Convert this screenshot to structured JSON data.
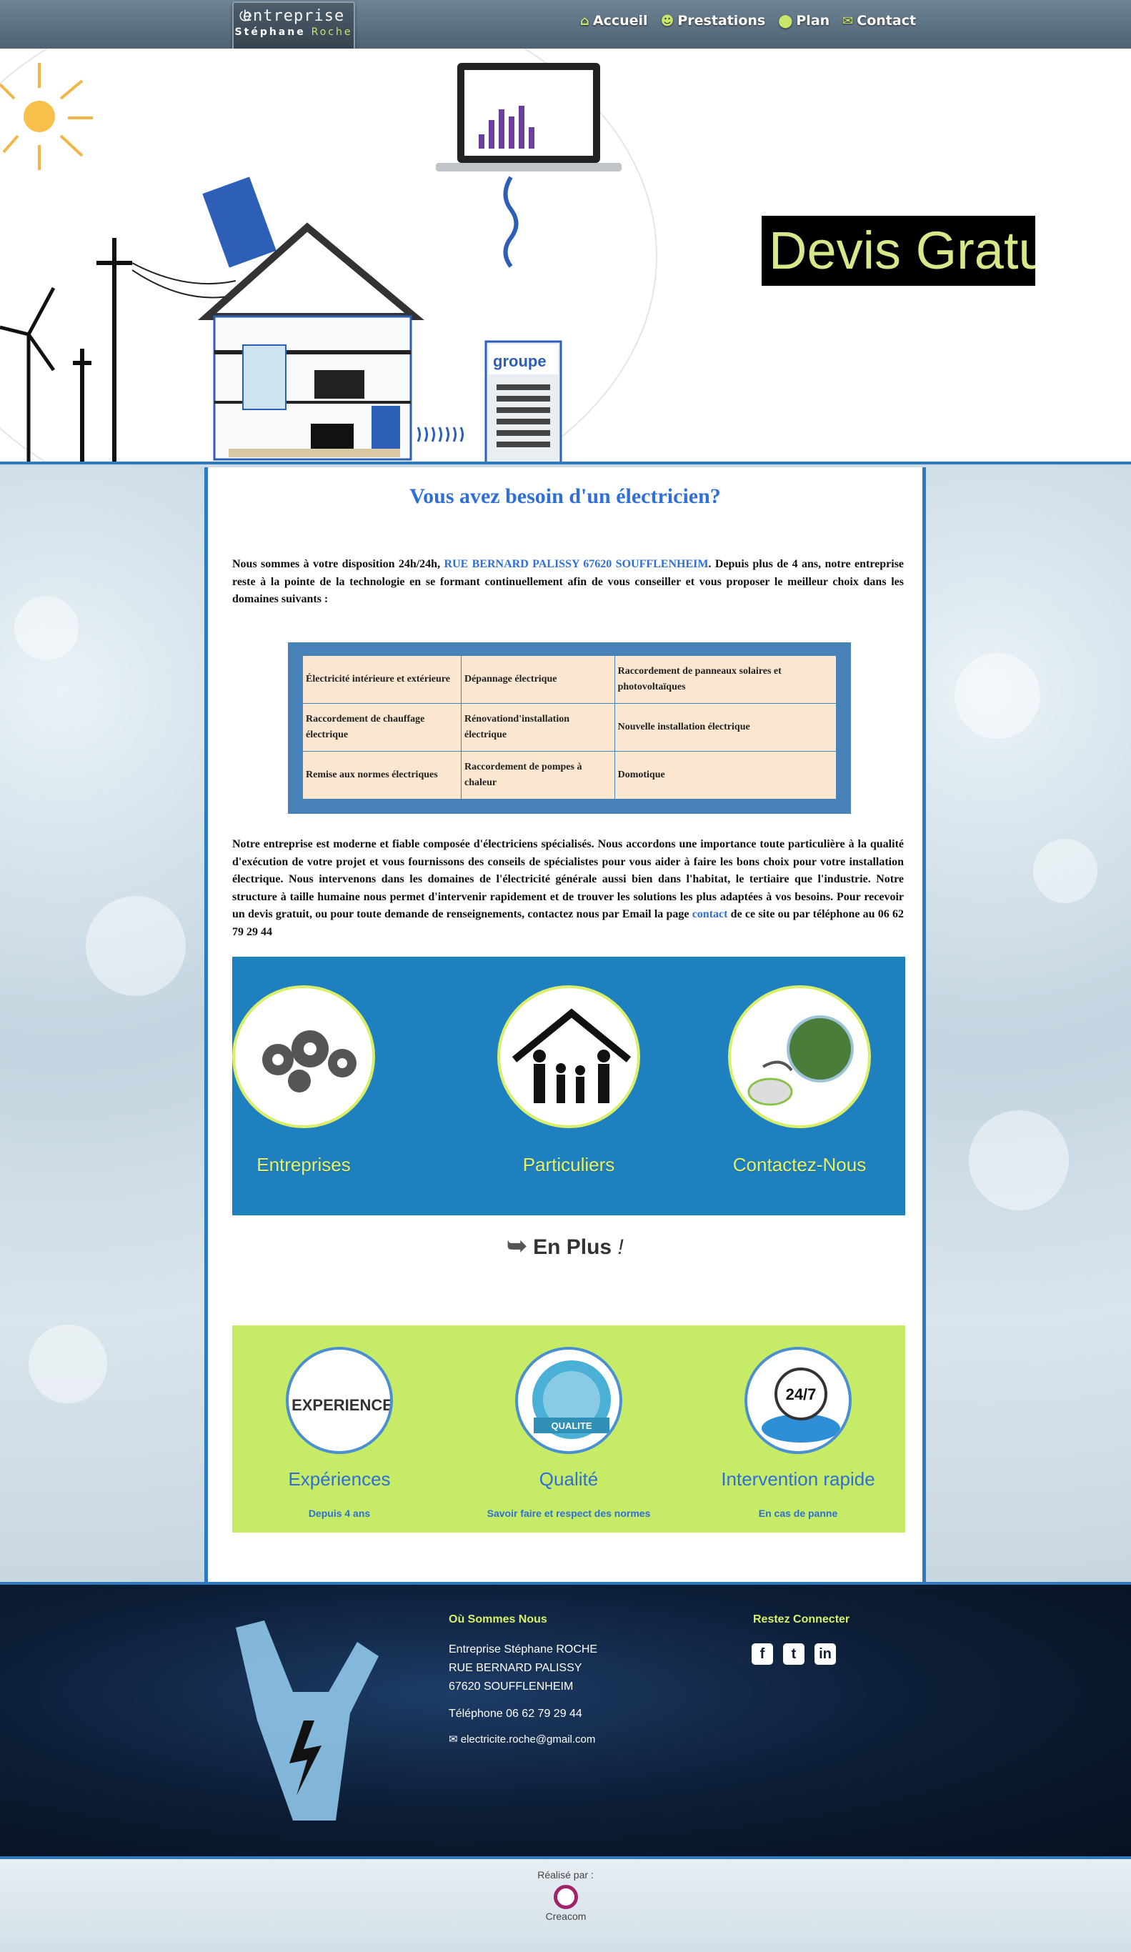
{
  "header": {
    "logo_line1": "entreprise",
    "logo_line2_first": "Stéphane ",
    "logo_line2_second": "Roche",
    "nav": [
      {
        "label": "Accueil",
        "icon": "home-icon"
      },
      {
        "label": "Prestations",
        "icon": "users-icon"
      },
      {
        "label": "Plan",
        "icon": "map-marker-icon"
      },
      {
        "label": "Contact",
        "icon": "envelope-icon"
      }
    ]
  },
  "hero": {
    "devis": "Devis Gratuit",
    "box_brand": "groupe"
  },
  "main": {
    "title": "Vous avez besoin d'un électricien?",
    "intro_pre": "Nous sommes  à votre disposition 24h/24h, ",
    "intro_link": "RUE BERNARD PALISSY 67620  SOUFFLENHEIM",
    "intro_post": ". Depuis plus de 4 ans, notre entreprise reste à la pointe de la technologie en se formant continuellement afin de vous conseiller et vous proposer le meilleur choix dans les domaines suivants :",
    "table": [
      [
        "Électricité intérieure et extérieure",
        "Dépannage électrique",
        "Raccordement de panneaux solaires et photovoltaïques"
      ],
      [
        "Raccordement de chauffage électrique",
        "Rénovationd'installation électrique",
        "Nouvelle installation électrique"
      ],
      [
        "Remise aux normes électriques",
        "Raccordement de pompes à chaleur",
        "Domotique"
      ]
    ],
    "para2_pre": "Notre entreprise est moderne et fiable composée d'électriciens spécialisés. Nous accordons une importance toute particulière à la qualité d'exécution de votre projet et vous fournissons des conseils de spécialistes pour vous aider à faire les bons choix pour votre installation électrique. Nous intervenons dans les domaines de l'électricité générale aussi bien dans l'habitat, le tertiaire que l'industrie. Notre structure à taille humaine nous permet d'intervenir rapidement et de trouver les solutions les plus adaptées à vos besoins. Pour recevoir un devis gratuit, ou pour toute demande de renseignements, contactez nous par Email  la page ",
    "para2_link": "contact",
    "para2_post": " de ce site ou par téléphone au  06 62 79 29 44",
    "tiles": [
      {
        "label": "Entreprises",
        "icon": "gears-icon"
      },
      {
        "label": "Particuliers",
        "icon": "family-house-icon"
      },
      {
        "label": "Contactez-Nous",
        "icon": "globe-mouse-icon"
      }
    ],
    "enplus": "En Plus",
    "enplus_mark": "!",
    "features": [
      {
        "label": "Expériences",
        "sub": "Depuis 4 ans",
        "icon": "experience-wordcloud-icon",
        "badge": "EXPERIENCE"
      },
      {
        "label": "Qualité",
        "sub": "Savoir faire et respect des normes",
        "icon": "quality-badge-icon",
        "badge": "QUALITE"
      },
      {
        "label": "Intervention rapide",
        "sub": "En cas de panne",
        "icon": "phone-24-7-icon",
        "badge": "24/7"
      }
    ]
  },
  "footer": {
    "where_title": "Où Sommes Nous",
    "company": "Entreprise Stéphane ROCHE",
    "street": "RUE BERNARD PALISSY",
    "city": "67620  SOUFFLENHEIM",
    "phone": "Téléphone 06 62 79 29 44",
    "email": "electricite.roche@gmail.com",
    "connect_title": "Restez Connecter",
    "social": [
      {
        "glyph": "f",
        "icon": "facebook-icon"
      },
      {
        "glyph": "t",
        "icon": "twitter-icon"
      },
      {
        "glyph": "in",
        "icon": "linkedin-icon"
      }
    ]
  },
  "bottom": {
    "made_by": "Réalisé par :",
    "agency": "Creacom"
  },
  "colors": {
    "accent_blue": "#2f79bf",
    "link_blue": "#2f6fd6",
    "lime": "#c6eb66"
  }
}
